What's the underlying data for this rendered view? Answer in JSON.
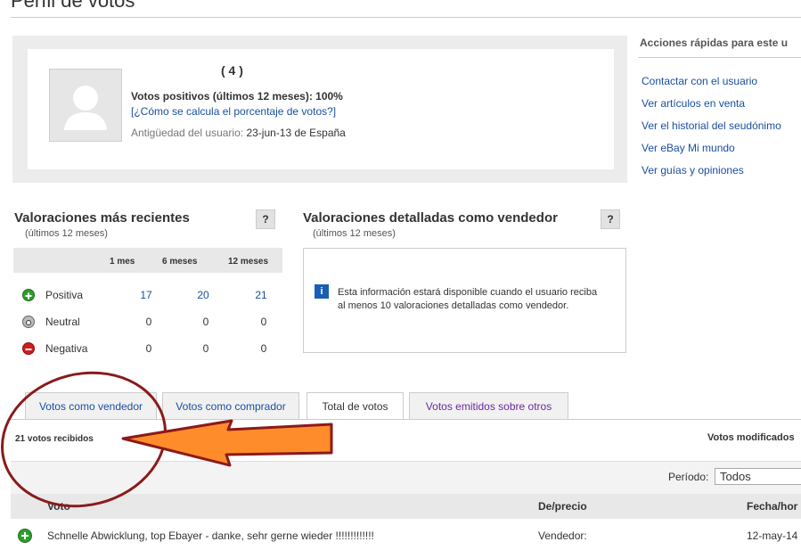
{
  "page": {
    "title": "Perfil de votos"
  },
  "profile": {
    "score": "( 4 )",
    "positive_votes": "Votos positivos (últimos 12 meses): 100%",
    "calc_link": "[¿Cómo se calcula el porcentaje de votos?]",
    "seniority_label": "Antigüedad del usuario:",
    "seniority_value": "23-jun-13 de España"
  },
  "quick_actions": {
    "title": "Acciones rápidas para este u",
    "links": [
      "Contactar con el usuario",
      "Ver artículos en venta",
      "Ver el historial del seudónimo",
      "Ver eBay Mi mundo",
      "Ver guías y opiniones"
    ]
  },
  "recent_ratings": {
    "title": "Valoraciones más recientes",
    "subtitle": "(últimos 12 meses)",
    "help": "?",
    "columns": [
      "1 mes",
      "6 meses",
      "12 meses"
    ],
    "rows": [
      {
        "label": "Positiva",
        "icon": "plus-circle-icon",
        "values": [
          "17",
          "20",
          "21"
        ]
      },
      {
        "label": "Neutral",
        "icon": "neutral-circle-icon",
        "values": [
          "0",
          "0",
          "0"
        ]
      },
      {
        "label": "Negativa",
        "icon": "minus-circle-icon",
        "values": [
          "0",
          "0",
          "0"
        ]
      }
    ]
  },
  "detailed_ratings": {
    "title": "Valoraciones detalladas como vendedor",
    "subtitle": "(últimos 12 meses)",
    "help": "?",
    "info_icon": "i",
    "info_text": "Esta información estará disponible cuando el usuario reciba al menos 10 valoraciones detalladas como vendedor."
  },
  "tabs": [
    {
      "label": "Votos como vendedor"
    },
    {
      "label": "Votos como comprador"
    },
    {
      "label": "Total de votos"
    },
    {
      "label": "Votos emitidos sobre otros"
    }
  ],
  "votes": {
    "count": "21 votos recibidos",
    "modified": "Votos modificados",
    "period_label": "Período:",
    "period_value": "Todos",
    "headers": {
      "vote": "Voto",
      "from": "De/precio",
      "date": "Fecha/hor"
    },
    "rows": [
      {
        "icon": "plus-circle-icon",
        "text": "Schnelle Abwicklung, top Ebayer - danke, sehr gerne wieder !!!!!!!!!!!!!",
        "from": "Vendedor:",
        "date": "12-may-14"
      }
    ]
  },
  "colors": {
    "link": "#1a4fa0",
    "positive": "#2e9e2e",
    "negative": "#cc1f1f",
    "annotation_arrow": "#ff8c2a",
    "annotation_outline": "#8b1a1a"
  }
}
